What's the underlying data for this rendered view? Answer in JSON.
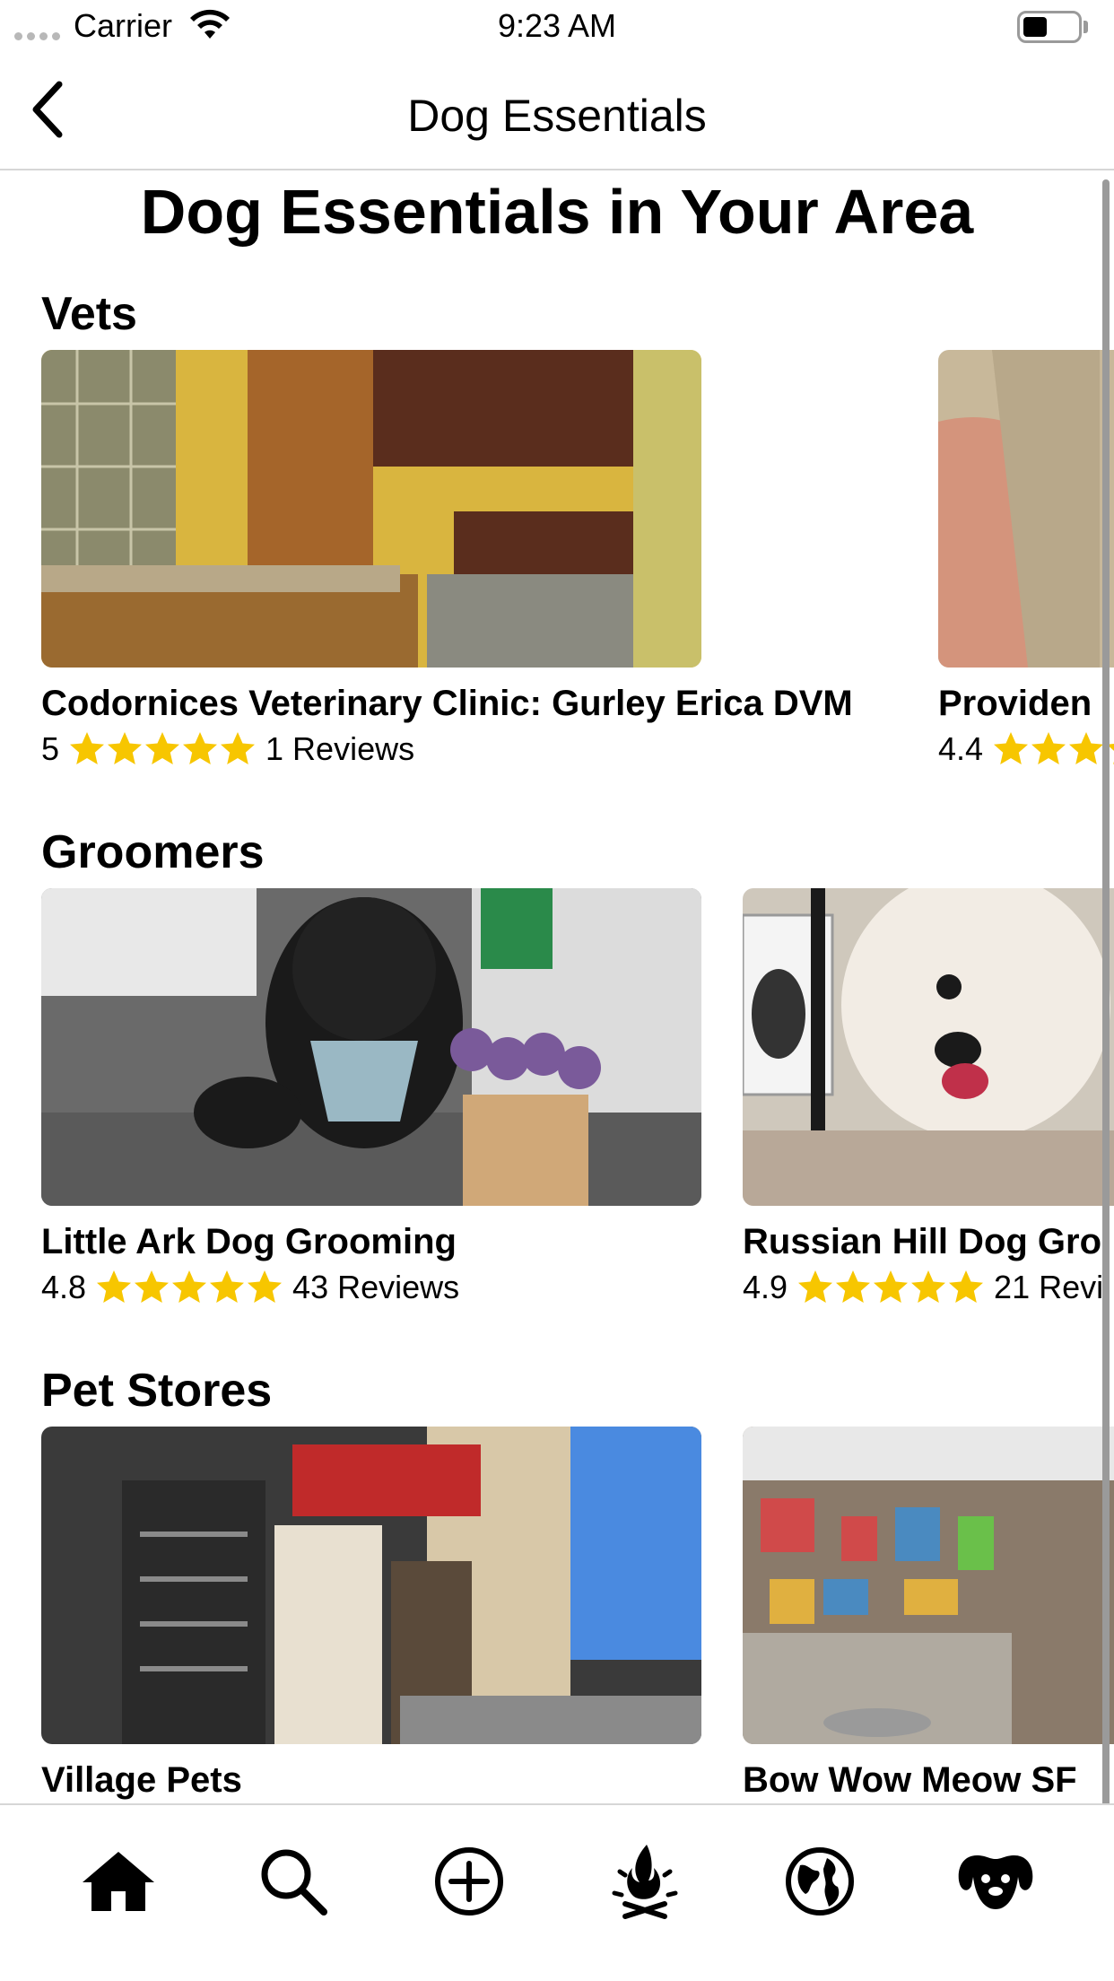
{
  "status_bar": {
    "carrier": "Carrier",
    "time": "9:23 AM"
  },
  "nav": {
    "title": "Dog Essentials",
    "back_icon": "chevron-left-icon"
  },
  "page": {
    "heading": "Dog Essentials in Your Area"
  },
  "sections": [
    {
      "title": "Vets",
      "cards": [
        {
          "name": "Codornices Veterinary Clinic: Gurley Erica DVM",
          "rating": "5",
          "reviews": "1 Reviews",
          "stars": 5
        },
        {
          "name": "Providen",
          "rating": "4.4",
          "reviews": "",
          "stars": 4.4
        }
      ]
    },
    {
      "title": "Groomers",
      "cards": [
        {
          "name": "Little Ark Dog Grooming",
          "rating": "4.8",
          "reviews": "43 Reviews",
          "stars": 5
        },
        {
          "name": "Russian Hill Dog Gro",
          "rating": "4.9",
          "reviews": "21 Revi",
          "stars": 5
        }
      ]
    },
    {
      "title": "Pet Stores",
      "cards": [
        {
          "name": "Village Pets",
          "rating": "",
          "reviews": "",
          "stars": 0
        },
        {
          "name": "Bow Wow Meow SF",
          "rating": "",
          "reviews": "",
          "stars": 0
        }
      ]
    }
  ],
  "tab_bar": {
    "tabs": [
      {
        "icon": "home-icon",
        "active": true
      },
      {
        "icon": "search-icon",
        "active": false
      },
      {
        "icon": "add-circle-icon",
        "active": false
      },
      {
        "icon": "campfire-icon",
        "active": false
      },
      {
        "icon": "globe-icon",
        "active": false
      },
      {
        "icon": "dog-face-icon",
        "active": false
      }
    ]
  },
  "colors": {
    "star": "#f7c600",
    "divider": "#d6d6d6",
    "scroll_indicator": "#9a9a9a"
  }
}
